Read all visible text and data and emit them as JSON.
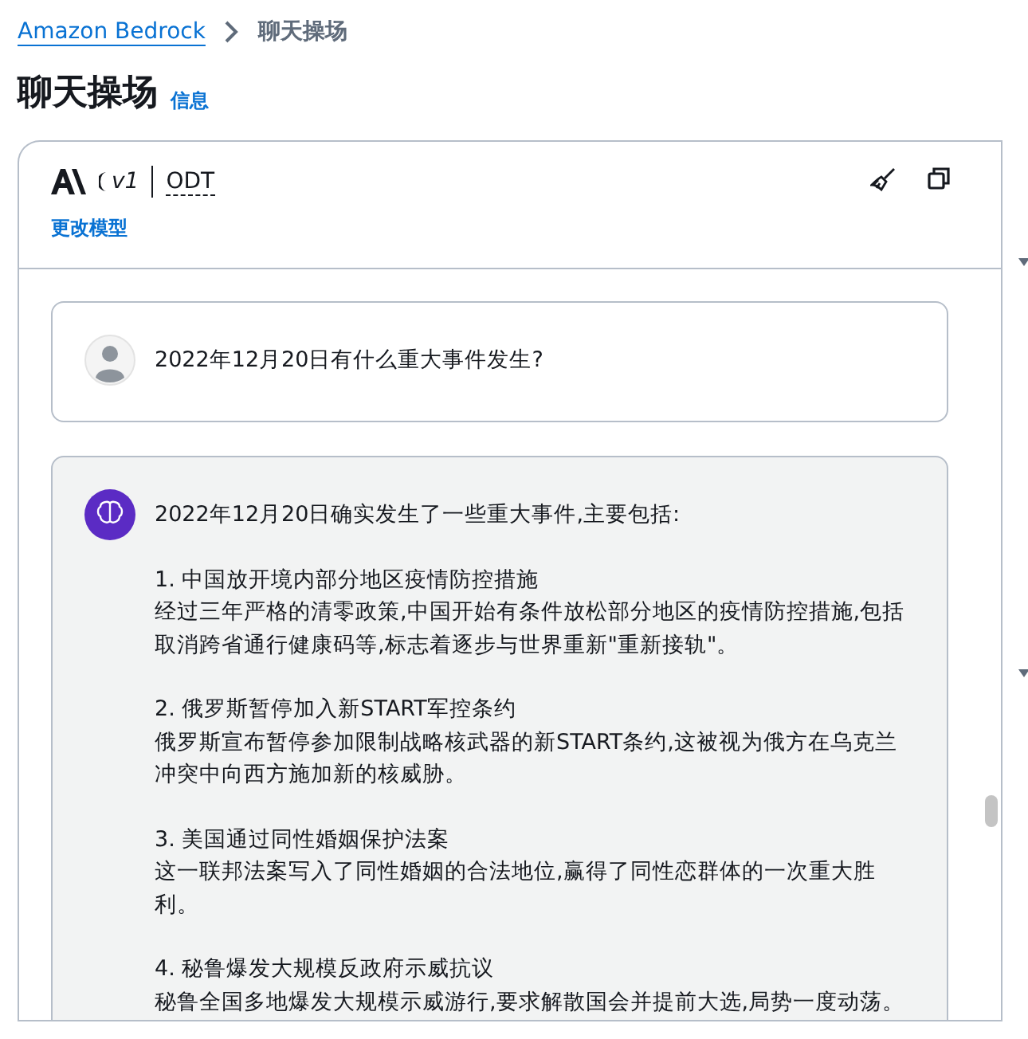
{
  "breadcrumb": [
    {
      "label": "Amazon Bedrock",
      "kind": "link"
    },
    {
      "label": "聊天操场",
      "kind": "current"
    }
  ],
  "page": {
    "title": "聊天操场",
    "info_link": "信息"
  },
  "model": {
    "version": "v1",
    "name": "ODT",
    "change_link": "更改模型"
  },
  "messages": [
    {
      "kind": "user",
      "paragraphs": [
        [
          "2022年12月20日有什么重大事件发生?"
        ]
      ]
    },
    {
      "kind": "assistant",
      "paragraphs": [
        [
          "2022年12月20日确实发生了一些重大事件,主要包括:"
        ],
        [
          "1. 中国放开境内部分地区疫情防控措施",
          "经过三年严格的清零政策,中国开始有条件放松部分地区的疫情防控措施,包括",
          "取消跨省通行健康码等,标志着逐步与世界重新\"重新接轨\"。"
        ],
        [
          "2. 俄罗斯暂停加入新START军控条约",
          "俄罗斯宣布暂停参加限制战略核武器的新START条约,这被视为俄方在乌克兰",
          "冲突中向西方施加新的核威胁。"
        ],
        [
          "3. 美国通过同性婚姻保护法案",
          "这一联邦法案写入了同性婚姻的合法地位,赢得了同性恋群体的一次重大胜",
          "利。"
        ],
        [
          "4. 秘鲁爆发大规模反政府示威抗议",
          "秘鲁全国多地爆发大规模示威游行,要求解散国会并提前大选,局势一度动荡。"
        ]
      ]
    }
  ]
}
